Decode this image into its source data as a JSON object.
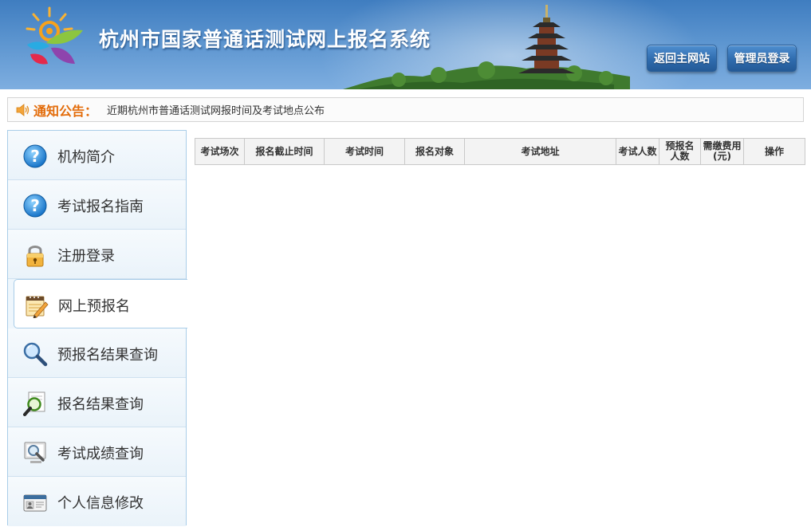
{
  "header": {
    "title": "杭州市国家普通话测试网上报名系统",
    "buttons": [
      {
        "label": "返回主网站"
      },
      {
        "label": "管理员登录"
      }
    ]
  },
  "notice": {
    "icon": "speaker-icon",
    "label": "通知公告：",
    "text": "近期杭州市普通话测试网报时间及考试地点公布"
  },
  "sidebar": {
    "active_index": 3,
    "items": [
      {
        "label": "机构简介",
        "icon": "question-icon"
      },
      {
        "label": "考试报名指南",
        "icon": "question-icon"
      },
      {
        "label": "注册登录",
        "icon": "padlock-icon"
      },
      {
        "label": "网上预报名",
        "icon": "notepad-pencil-icon"
      },
      {
        "label": "预报名结果查询",
        "icon": "magnifier-icon"
      },
      {
        "label": "报名结果查询",
        "icon": "magnifier-document-icon"
      },
      {
        "label": "考试成绩查询",
        "icon": "magnifier-screen-icon"
      },
      {
        "label": "个人信息修改",
        "icon": "id-card-icon"
      }
    ]
  },
  "table": {
    "columns": [
      {
        "label": "考试场次"
      },
      {
        "label": "报名截止时间"
      },
      {
        "label": "考试时间"
      },
      {
        "label": "报名对象"
      },
      {
        "label": "考试地址"
      },
      {
        "label": "考试人数"
      },
      {
        "label": "预报名人数"
      },
      {
        "label": "需缴费用(元)"
      },
      {
        "label": "操作"
      }
    ],
    "rows": []
  },
  "colors": {
    "header_blue": "#3f7dc0",
    "notice_orange": "#e36c0a",
    "sidebar_border": "#a9cde8"
  }
}
